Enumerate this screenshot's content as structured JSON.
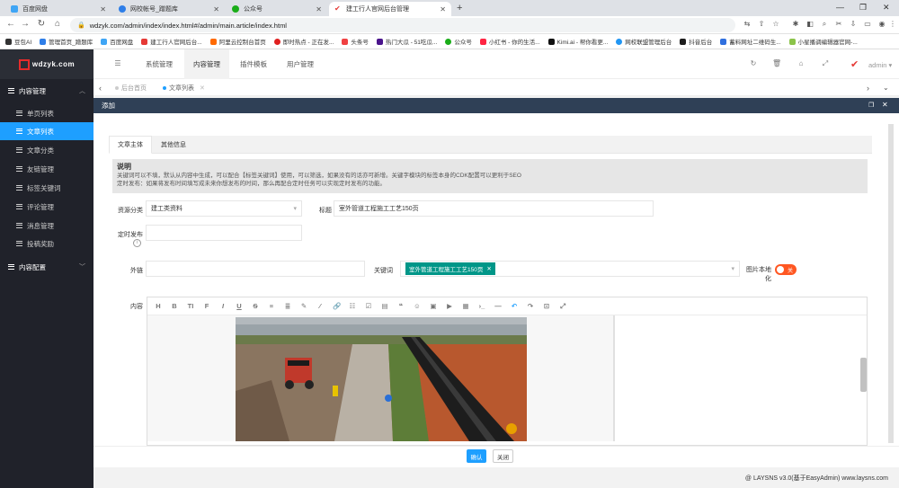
{
  "browser": {
    "tabs": [
      {
        "title": "百度网盘",
        "icon_color": "#3fa5f5"
      },
      {
        "title": "网校帐号_蹭题库",
        "icon_color": "#2e7ee8"
      },
      {
        "title": "公众号",
        "icon_color": "#1aad19"
      },
      {
        "title": "建工行人官网后台管理",
        "icon_color": "#e53935"
      }
    ],
    "url": "wdzyk.com/admin/index/index.html#/admin/main.article/index.html",
    "bookmarks": [
      "豆包AI",
      "管理首页_蹭题库",
      "百度网盘",
      "建工行人官网后台...",
      "阿里云控制台首页",
      "即时热点 - 正在发...",
      "头条号",
      "热门大瓜 - 51吃瓜...",
      "公众号",
      "小红书 - 你的生活...",
      "Kimi.ai - 帮你看更...",
      "网校联盟管理后台",
      "抖音后台",
      "蓄料网址二维码生...",
      "小星播调编辑器官网-..."
    ]
  },
  "sidebar": {
    "logo_text": "wdzyk.com",
    "groups": [
      {
        "label": "内容管理",
        "expanded": true,
        "items": [
          "单页列表",
          "文章列表",
          "文章分类",
          "友链管理",
          "标签关键词",
          "评论管理",
          "消息管理",
          "投稿奖励"
        ]
      },
      {
        "label": "内容配置",
        "expanded": false,
        "items": []
      }
    ],
    "active_item": "文章列表"
  },
  "topnav": {
    "items": [
      "系统管理",
      "内容管理",
      "插件模板",
      "用户管理"
    ],
    "active": "内容管理",
    "user": "admin"
  },
  "pagetabs": {
    "items": [
      "后台首页",
      "文章列表"
    ],
    "active": "文章列表"
  },
  "dialog": {
    "title": "添加",
    "tabs": [
      "文章主体",
      "其他信息"
    ],
    "active_tab": "文章主体",
    "note": {
      "title": "说明",
      "line1": "关键词可以不填，默认从内容中生成，可以配合【标签关键词】使用，可以筛选，如果没有的话亦可新增。关键字模块的标签本身的CDK配置可以更利于SEO",
      "line2": "定时发布：如果将发布时间填写成未来你想发布的时间，那么再配合定时任务可以实现定时发布的功能。"
    },
    "fields": {
      "category_label": "资源分类",
      "category_value": "建工类资料",
      "title_label": "标题",
      "title_value": "室外管道工程施工工艺150页",
      "schedule_label": "定时发布",
      "link_label": "外链",
      "link_value": "",
      "keywords_label": "关键词",
      "keyword_tag": "室外管道工程施工工艺150页",
      "localize_label": "图片本地化",
      "localize_state": "关",
      "content_label": "内容"
    },
    "toolbar": [
      "H",
      "B",
      "TI",
      "F",
      "I",
      "U",
      "S",
      "≡",
      "≣",
      "✎",
      "⁄",
      "🔗",
      "☷",
      "☑",
      "▤",
      "❝",
      "☺",
      "▣",
      "▶",
      "▦",
      "›_",
      "—",
      "↶",
      "↷",
      "⊡",
      "⤢"
    ],
    "buttons": {
      "confirm": "确认",
      "close": "关闭"
    }
  },
  "footer": {
    "text": "@ LAYSNS v3.0(基于EasyAdmin) www.laysns.com"
  },
  "colors": {
    "sidebar_bg": "#20222a",
    "active_blue": "#1e9fff",
    "dialog_head": "#2f4056",
    "tag_green": "#009688",
    "toggle_off": "#ff5722"
  }
}
